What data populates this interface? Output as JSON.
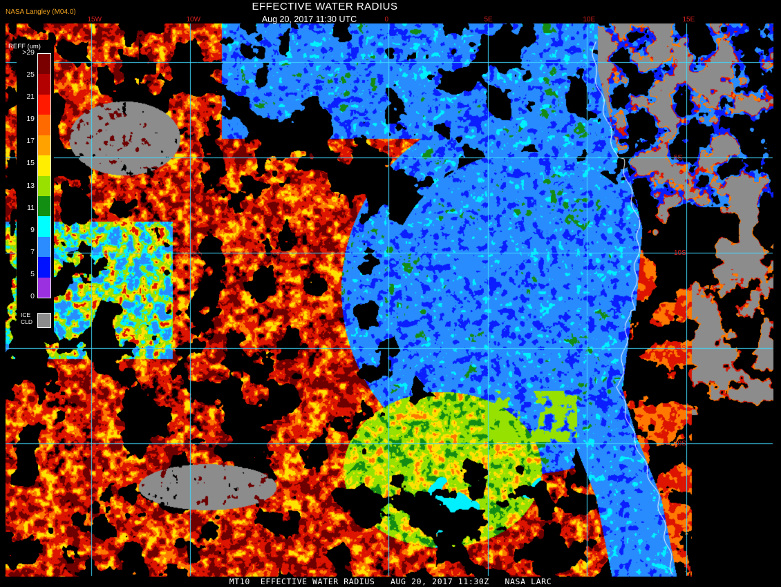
{
  "header": {
    "credit": "NASA Langley (M04.0)",
    "title": "EFFECTIVE WATER RADIUS",
    "datetime": "Aug 20, 2017 11:30 UTC"
  },
  "footer": {
    "caption": "MT10  EFFECTIVE WATER RADIUS   AUG 20, 2017 11:30Z   NASA LARC"
  },
  "legend": {
    "title": "REFF (um)",
    "ticks": [
      ">29",
      "25",
      "21",
      "19",
      "17",
      "15",
      "13",
      "11",
      "9",
      "7",
      "5",
      "0"
    ],
    "colors": [
      "#7a0000",
      "#b30000",
      "#ff1a00",
      "#ff6a00",
      "#ffa200",
      "#ffee00",
      "#99e000",
      "#128f12",
      "#00ffff",
      "#2a8cff",
      "#0012ff",
      "#9a30e0"
    ],
    "ice_label_line1": "ICE",
    "ice_label_line2": "CLD",
    "ice_color": "#8c8c8c"
  },
  "grid": {
    "longitudes": [
      {
        "label": "15W",
        "value": -15
      },
      {
        "label": "10W",
        "value": -10
      },
      {
        "label": "0",
        "value": 0
      },
      {
        "label": "5E",
        "value": 5
      },
      {
        "label": "10E",
        "value": 10
      },
      {
        "label": "15E",
        "value": 15
      }
    ],
    "latitudes": [
      {
        "label": "0",
        "value": 0
      },
      {
        "label": "5S",
        "value": -5
      },
      {
        "label": "10S",
        "value": -10
      },
      {
        "label": "15S",
        "value": -15
      },
      {
        "label": "20S",
        "value": -20
      }
    ],
    "line_color": "#3fd9ff",
    "label_color": "#d9201f"
  }
}
